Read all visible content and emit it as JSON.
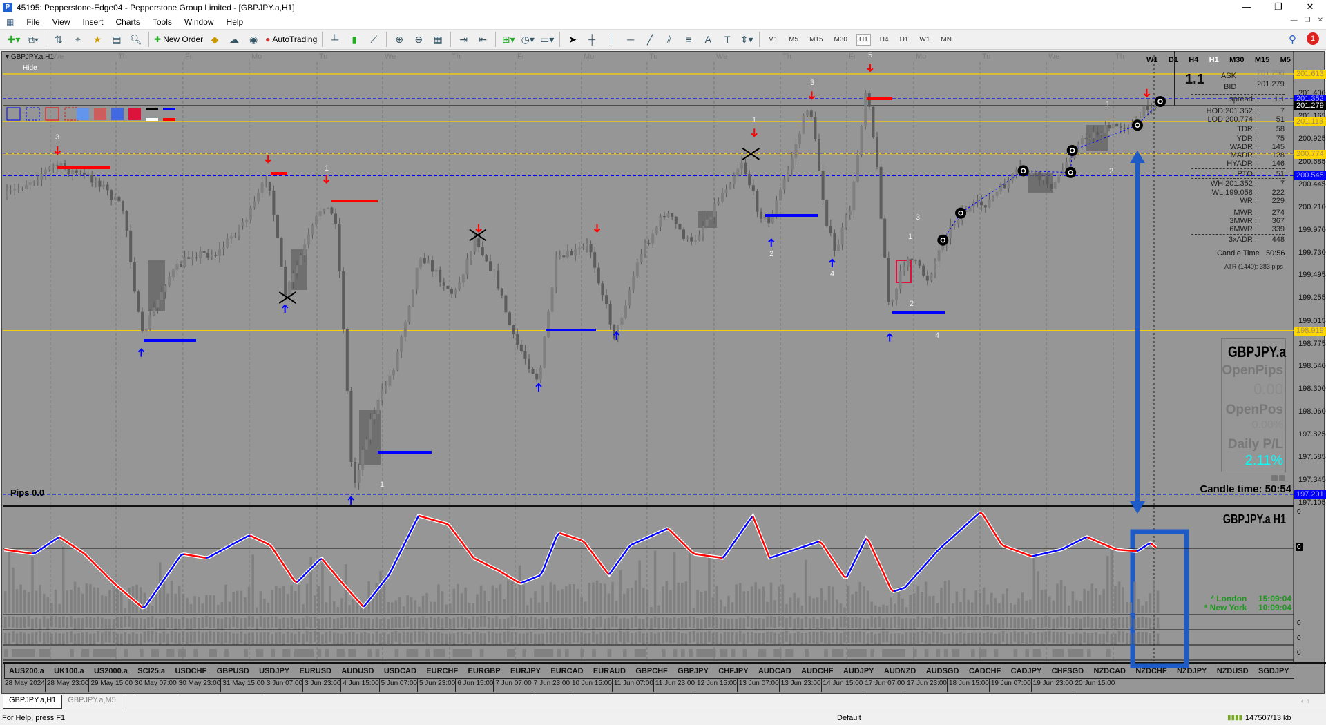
{
  "window": {
    "title": "45195: Pepperstone-Edge04 - Pepperstone Group Limited - [GBPJPY.a,H1]",
    "controls": [
      "—",
      "❐",
      "✕"
    ]
  },
  "menu": [
    "File",
    "View",
    "Insert",
    "Charts",
    "Tools",
    "Window",
    "Help"
  ],
  "toolbar": {
    "new_order": "New Order",
    "autotrading": "AutoTrading",
    "timeframes": [
      "M1",
      "M5",
      "M15",
      "M30",
      "H1",
      "H4",
      "D1",
      "W1",
      "MN"
    ],
    "active_timeframe": "H1",
    "notification_count": "1"
  },
  "chart": {
    "symbol_label": "GBPJPY.a,H1",
    "hide_label": "Hide",
    "days": [
      "We",
      "Th",
      "Fr",
      "Mo",
      "Tu",
      "We",
      "Th",
      "Fr",
      "Mo",
      "Tu",
      "We",
      "Th",
      "Fr",
      "Mo",
      "Tu",
      "We",
      "Th"
    ],
    "price_ticks": [
      "201.400",
      "201.165",
      "200.925",
      "200.685",
      "200.445",
      "200.210",
      "199.970",
      "199.730",
      "199.495",
      "199.255",
      "199.015",
      "198.775",
      "198.540",
      "198.300",
      "198.060",
      "197.825",
      "197.585",
      "197.345",
      "197.105"
    ],
    "price_tags": [
      {
        "value": "201.613",
        "bg": "#ffd700",
        "fg": "#a09060"
      },
      {
        "value": "201.352",
        "bg": "#0000ff",
        "fg": "#b0b0ff"
      },
      {
        "value": "201.279",
        "bg": "#000000",
        "fg": "#ffffff"
      },
      {
        "value": "201.113",
        "bg": "#ffd700",
        "fg": "#a09060"
      },
      {
        "value": "200.774",
        "bg": "#ffd700",
        "fg": "#a09060"
      },
      {
        "value": "200.545",
        "bg": "#0000ff",
        "fg": "#b0b0ff"
      },
      {
        "value": "198.919",
        "bg": "#ffd700",
        "fg": "#a09060"
      },
      {
        "value": "197.201",
        "bg": "#0000ff",
        "fg": "#b0b0ff"
      }
    ],
    "markers": [
      "3",
      "1",
      "1",
      "3",
      "5",
      "1",
      "2",
      "3",
      "1",
      "2",
      "4",
      "2",
      "4",
      "1"
    ],
    "tf_switcher": [
      "W1",
      "D1",
      "H4",
      "H1",
      "M30",
      "M15",
      "M5"
    ],
    "tf_switcher_active": "H1",
    "spread_big": "1.1",
    "ask_label": "ASK",
    "ask_value": "201.290",
    "bid_label": "BID",
    "bid_value": "201.279",
    "info_rows": [
      {
        "label": "spread :",
        "value": "1.1"
      },
      {
        "label": "HOD:201.352 :",
        "value": "7"
      },
      {
        "label": "LOD:200.774 :",
        "value": "51"
      },
      {
        "label": "TDR :",
        "value": "58"
      },
      {
        "label": "YDR :",
        "value": "75"
      },
      {
        "label": "WADR :",
        "value": "145"
      },
      {
        "label": "MADR :",
        "value": "128"
      },
      {
        "label": "HYADR :",
        "value": "146"
      },
      {
        "label": "PTO :",
        "value": "51"
      },
      {
        "label": "WH:201.352 :",
        "value": "7"
      },
      {
        "label": "WL:199.058 :",
        "value": "222"
      },
      {
        "label": "WR :",
        "value": "229"
      },
      {
        "label": "MWR :",
        "value": "274"
      },
      {
        "label": "3MWR :",
        "value": "367"
      },
      {
        "label": "6MWR :",
        "value": "339"
      },
      {
        "label": "3xADR :",
        "value": "448"
      }
    ],
    "candle_time_small": {
      "label": "Candle Time",
      "value": "50:56"
    },
    "atr": "ATR (1440): 383 pips",
    "panel": {
      "symbol": "GBPJPY.a",
      "open_pips_label": "OpenPips",
      "open_pips": "0.00",
      "open_pos_label": "OpenPos",
      "open_pos": "0.00%",
      "daily_pl_label": "Daily P/L",
      "daily_pl": "2.11%",
      "daily_pl_color": "#00ffff"
    },
    "candle_time": "Candle time:  50:54",
    "pips": "Pips 0.0"
  },
  "indicator": {
    "title": "GBPJPY.a  H1",
    "zero": "0",
    "level": "0",
    "sub_levels": [
      "0",
      "0",
      "0"
    ],
    "london": "* London     15:09:04",
    "new_york": "* New York     10:09:04",
    "up_color": "#0000ff",
    "down_color": "#ff0000"
  },
  "symbols": [
    "AUS200.a",
    "UK100.a",
    "US2000.a",
    "SCI25.a",
    "USDCHF",
    "GBPUSD",
    "USDJPY",
    "EURUSD",
    "AUDUSD",
    "USDCAD",
    "EURCHF",
    "EURGBP",
    "EURJPY",
    "EURCAD",
    "EURAUD",
    "GBPCHF",
    "GBPJPY",
    "CHFJPY",
    "AUDCAD",
    "AUDCHF",
    "AUDJPY",
    "AUDNZD",
    "AUDSGD",
    "CADCHF",
    "CADJPY",
    "CHFSGD",
    "NZDCAD",
    "NZDCHF",
    "NZDJPY",
    "NZDUSD",
    "SGDJPY"
  ],
  "dates": [
    "28 May 2024",
    "28 May 23:00",
    "29 May 15:00",
    "30 May 07:00",
    "30 May 23:00",
    "31 May 15:00",
    "3 Jun 07:00",
    "3 Jun 23:00",
    "4 Jun 15:00",
    "5 Jun 07:00",
    "5 Jun 23:00",
    "6 Jun 15:00",
    "7 Jun 07:00",
    "7 Jun 23:00",
    "10 Jun 15:00",
    "11 Jun 07:00",
    "11 Jun 23:00",
    "12 Jun 15:00",
    "13 Jun 07:00",
    "13 Jun 23:00",
    "14 Jun 15:00",
    "17 Jun 07:00",
    "17 Jun 23:00",
    "18 Jun 15:00",
    "19 Jun 07:00",
    "19 Jun 23:00",
    "20 Jun 15:00"
  ],
  "tabs": [
    {
      "label": "GBPJPY.a,H1",
      "active": true
    },
    {
      "label": "GBPJPY.a,M5",
      "active": false
    }
  ],
  "status": {
    "help": "For Help, press F1",
    "profile": "Default",
    "traffic": "147507/13 kb"
  }
}
